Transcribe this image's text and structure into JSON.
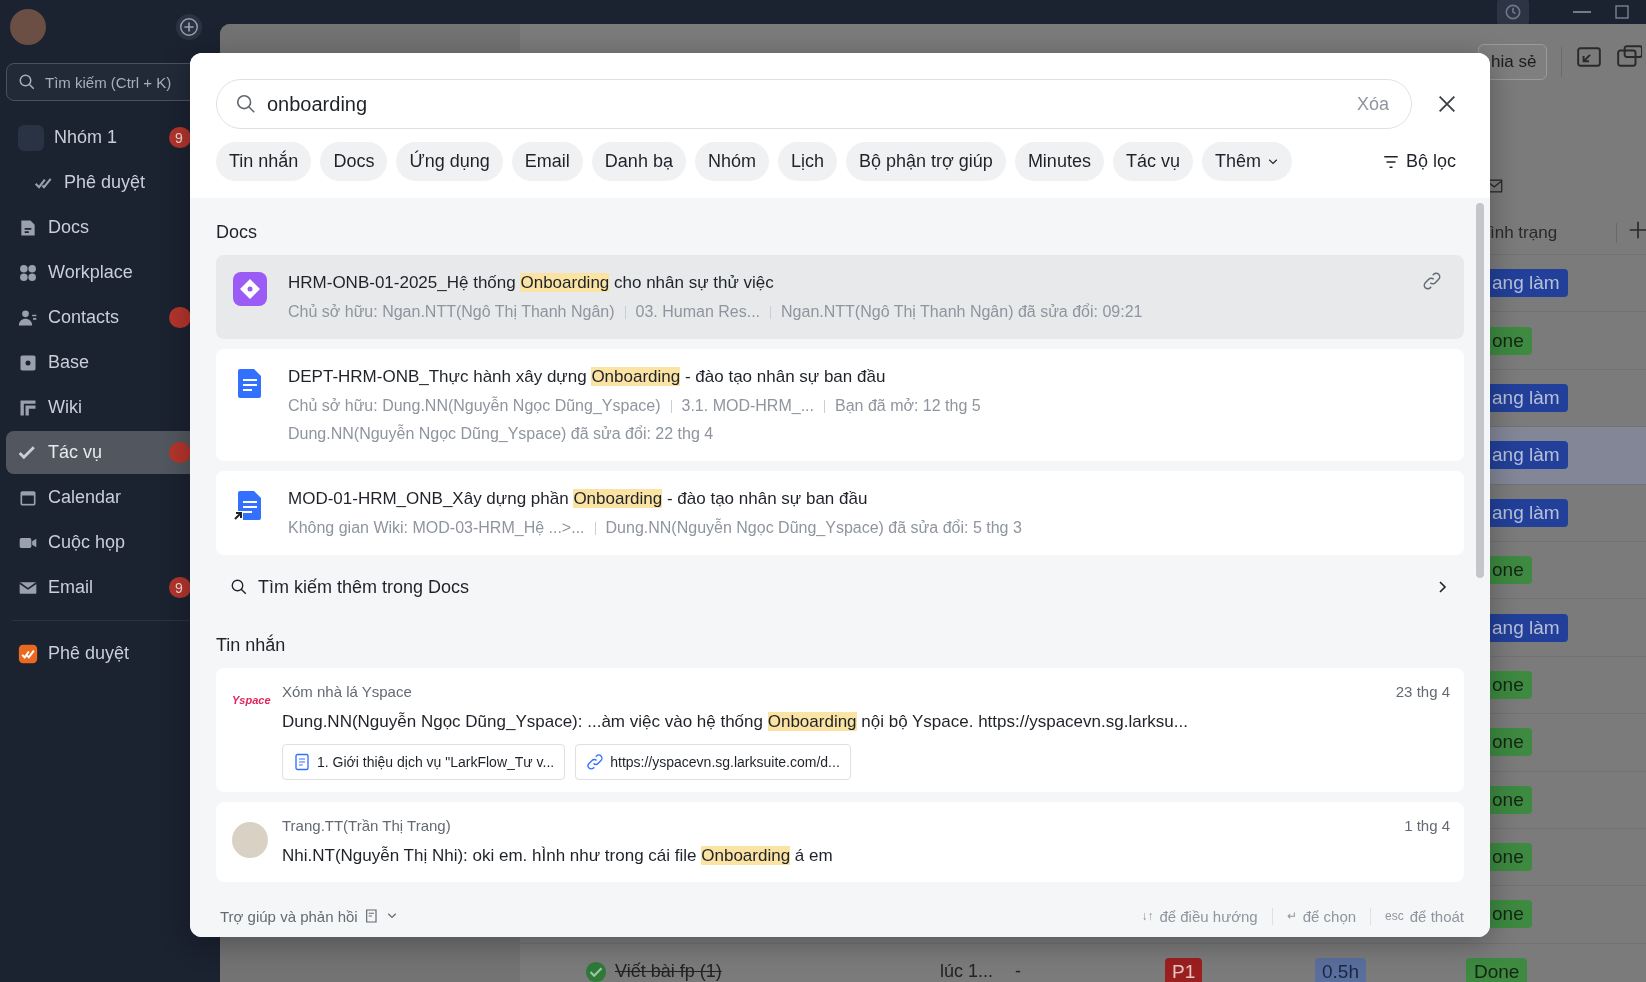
{
  "sidebar": {
    "search_placeholder": "Tìm kiếm (Ctrl + K)",
    "items": [
      {
        "label": "Nhóm 1",
        "kind": "group",
        "selected": false,
        "unread": true,
        "badge": "9",
        "children": [
          {
            "label": "Phê duyệt",
            "kind": "approval",
            "selected": false
          }
        ]
      },
      {
        "label": "Docs",
        "kind": "docs",
        "selected": false,
        "unread": false
      },
      {
        "label": "Workplace",
        "kind": "workplace",
        "selected": false,
        "unread": false
      },
      {
        "label": "Contacts",
        "kind": "contacts",
        "selected": false,
        "unread": true
      },
      {
        "label": "Base",
        "kind": "base",
        "selected": false,
        "unread": false
      },
      {
        "label": "Wiki",
        "kind": "wiki",
        "selected": false,
        "unread": false
      },
      {
        "label": "Tác vụ",
        "kind": "tasks",
        "selected": true,
        "unread": true
      },
      {
        "label": "Calendar",
        "kind": "calendar",
        "selected": false,
        "unread": false
      },
      {
        "label": "Cuộc họp",
        "kind": "meeting",
        "selected": false,
        "unread": false
      },
      {
        "label": "Email",
        "kind": "email",
        "selected": false,
        "unread": true,
        "badge": "9"
      }
    ],
    "apps": [
      {
        "label": "Phê duyệt",
        "kind": "approval-app",
        "selected": false,
        "unread": false
      }
    ]
  },
  "background": {
    "share_button": "hia sẻ",
    "status_header": "ình trạng",
    "rows": [
      {
        "kind": "doing",
        "status": "ang làm",
        "selected": false
      },
      {
        "kind": "done",
        "status": "one",
        "selected": false
      },
      {
        "kind": "doing",
        "status": "ang làm",
        "selected": false
      },
      {
        "kind": "doing",
        "status": "ang làm",
        "selected": true
      },
      {
        "kind": "doing",
        "status": "ang làm",
        "selected": false
      },
      {
        "kind": "done",
        "status": "one",
        "selected": false
      },
      {
        "kind": "doing",
        "status": "ang làm",
        "selected": false
      },
      {
        "kind": "done",
        "status": "one",
        "selected": false
      },
      {
        "kind": "done",
        "status": "one",
        "selected": false
      },
      {
        "kind": "done",
        "status": "one",
        "selected": false
      },
      {
        "kind": "done",
        "status": "one",
        "selected": false
      },
      {
        "kind": "done",
        "status": "one",
        "selected": false
      },
      {
        "kind": "done",
        "status": "Done",
        "selected": false,
        "task": "Viết bài fp (1)",
        "completed": true,
        "time": "lúc 1...",
        "assignee": "-",
        "priority": "P1",
        "estimate": "0.5h"
      }
    ]
  },
  "search_modal": {
    "query": "onboarding",
    "clear": "Xóa",
    "chips": [
      {
        "label": "Tin nhắn",
        "kind": "chip"
      },
      {
        "label": "Docs",
        "kind": "chip"
      },
      {
        "label": "Ứng dụng",
        "kind": "chip"
      },
      {
        "label": "Email",
        "kind": "chip"
      },
      {
        "label": "Danh bạ",
        "kind": "chip"
      },
      {
        "label": "Nhóm",
        "kind": "chip"
      },
      {
        "label": "Lịch",
        "kind": "chip"
      },
      {
        "label": "Bộ phận trợ giúp",
        "kind": "chip"
      },
      {
        "label": "Minutes",
        "kind": "chip"
      },
      {
        "label": "Tác vụ",
        "kind": "chip"
      },
      {
        "label": "Thêm",
        "kind": "dropdown"
      }
    ],
    "filter": "Bộ lọc",
    "docs": {
      "title": "Docs",
      "more": "Tìm kiếm thêm trong Docs",
      "results": [
        {
          "kind": "base",
          "selected": true,
          "title": [
            {
              "text": "HRM-ONB-01-2025_Hệ thống ",
              "highlight": false
            },
            {
              "text": "Onboarding",
              "highlight": true
            },
            {
              "text": " cho nhân sự thử việc",
              "highlight": false
            }
          ],
          "meta": [
            [
              "Chủ sở hữu:  Ngan.NTT(Ngô Thị Thanh Ngân)",
              "03. Human Res...",
              "Ngan.NTT(Ngô Thị Thanh Ngân)  đã sửa đổi: 09:21"
            ]
          ]
        },
        {
          "kind": "doc",
          "selected": false,
          "title": [
            {
              "text": "DEPT-HRM-ONB_Thực hành xây dựng ",
              "highlight": false
            },
            {
              "text": "Onboarding",
              "highlight": true
            },
            {
              "text": " - đào tạo nhân sự ban đầu",
              "highlight": false
            }
          ],
          "meta": [
            [
              "Chủ sở hữu:  Dung.NN(Nguyễn Ngọc Dũng_Yspace)",
              "3.1. MOD-HRM_...",
              "Bạn đã mở: 12 thg 5"
            ],
            [
              "Dung.NN(Nguyễn Ngọc Dũng_Yspace)  đã sửa đổi: 22 thg 4"
            ]
          ]
        },
        {
          "kind": "doc-shortcut",
          "selected": false,
          "title": [
            {
              "text": "MOD-01-HRM_ONB_Xây dựng phần ",
              "highlight": false
            },
            {
              "text": "Onboarding",
              "highlight": true
            },
            {
              "text": " - đào tạo nhân sự ban đầu",
              "highlight": false
            }
          ],
          "meta": [
            [
              "Không gian Wiki: MOD-03-HRM_Hệ ...>...",
              "Dung.NN(Nguyễn Ngọc Dũng_Yspace)  đã sửa đổi: 5 thg 3"
            ]
          ]
        }
      ]
    },
    "messages": {
      "title": "Tin nhắn",
      "results": [
        {
          "kind": "logo",
          "logo_text": "Yspace",
          "chat": "Xóm nhà lá Yspace",
          "date": "23 thg 4",
          "text": [
            {
              "text": "Dung.NN(Nguyễn Ngọc Dũng_Yspace): ...àm việc vào hệ thống ",
              "highlight": false
            },
            {
              "text": "Onboarding",
              "highlight": true
            },
            {
              "text": " nội bộ Yspace. https://yspacevn.sg.larksu...",
              "highlight": false
            }
          ],
          "attachments": [
            {
              "kind": "doc",
              "text": "1. Giới thiệu dịch vụ \"LarkFlow_Tư v..."
            },
            {
              "kind": "link",
              "text": "https://yspacevn.sg.larksuite.com/d..."
            }
          ]
        },
        {
          "kind": "photo",
          "chat": "Trang.TT(Trần Thị Trang)",
          "date": "1 thg 4",
          "text": [
            {
              "text": "Nhi.NT(Nguyễn Thị Nhi): oki em. hÌnh như trong cái file ",
              "highlight": false
            },
            {
              "text": "Onboarding",
              "highlight": true
            },
            {
              "text": " á em",
              "highlight": false
            }
          ]
        }
      ]
    },
    "footer": {
      "help": "Trợ giúp và phản hồi",
      "hints": [
        {
          "key": "↓↑",
          "text": "để điều hướng"
        },
        {
          "key": "↵",
          "text": "để chọn"
        },
        {
          "key": "esc",
          "text": "để thoát"
        }
      ]
    }
  }
}
